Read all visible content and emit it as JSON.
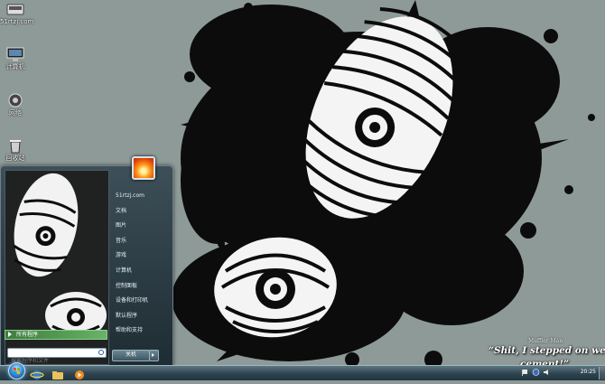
{
  "desktop": {
    "icons": [
      {
        "label": "51rtzj.com",
        "icon": "network-folder-icon"
      },
      {
        "label": "计算机",
        "icon": "computer-icon"
      },
      {
        "label": "网络",
        "icon": "network-globe-icon"
      },
      {
        "label": "回收站",
        "icon": "recycle-bin-icon"
      }
    ],
    "wallpaper": {
      "quote_credit": "Muffler Man",
      "quote_line1": "“Shit, I stepped on wet",
      "quote_line2": "cement!”",
      "colors": {
        "background": "#8e9a97",
        "ink": "#0a0a0a",
        "sole": "#ffffff"
      }
    }
  },
  "start_menu": {
    "right_links": [
      "51rtzj.com",
      "文档",
      "图片",
      "音乐",
      "游戏",
      "计算机",
      "控制面板",
      "设备和打印机",
      "默认程序",
      "帮助和支持"
    ],
    "all_programs": "所有程序",
    "search_placeholder": "搜索程序和文件",
    "shutdown_label": "关机",
    "accent_color": "#5aa359"
  },
  "taskbar": {
    "clock": "20:25",
    "pinned": [
      "internet-explorer-icon",
      "explorer-folder-icon",
      "media-player-icon"
    ],
    "tray_icons": [
      "flag-icon",
      "network-icon",
      "volume-icon"
    ]
  }
}
